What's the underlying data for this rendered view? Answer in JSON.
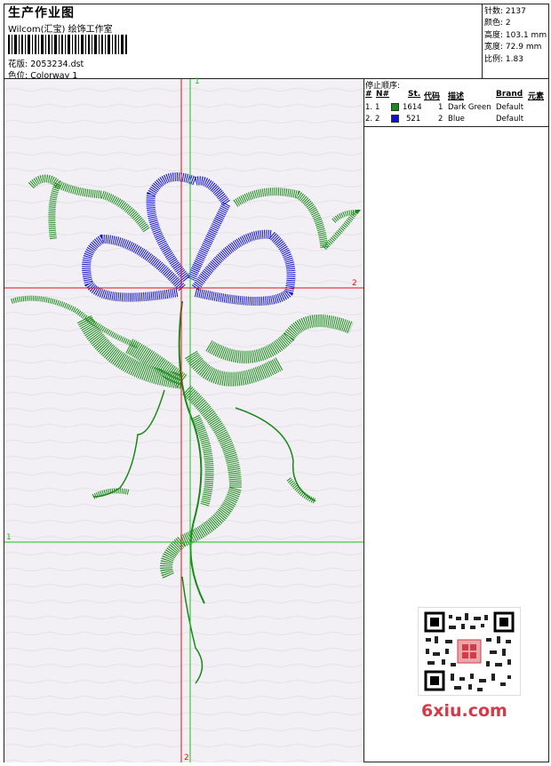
{
  "header": {
    "title": "生产作业图",
    "company": "Wilcom(汇宝) 绘饰工作室",
    "file_label": "花版:",
    "file_name": "2053234.dst",
    "colorway_label": "色位:",
    "colorway": "Colorway 1"
  },
  "stats": {
    "stitches_label": "针数:",
    "stitches": "2137",
    "colors_label": "颜色:",
    "colors": "2",
    "height_label": "高度:",
    "height": "103.1 mm",
    "width_label": "宽度:",
    "width": "72.9 mm",
    "scale_label": "比例:",
    "scale": "1.83"
  },
  "stop_sequence": {
    "title": "停止顺序:",
    "columns": [
      "#",
      "N#",
      "St.",
      "代码",
      "描述",
      "Brand",
      "元素"
    ],
    "rows": [
      {
        "idx": "1.",
        "n": "1",
        "color": "#1a8a1a",
        "stitches": "1614",
        "code": "1",
        "desc": "Dark Green",
        "brand": "Default"
      },
      {
        "idx": "2.",
        "n": "2",
        "color": "#1010d8",
        "stitches": "521",
        "code": "2",
        "desc": "Blue",
        "brand": "Default"
      }
    ]
  },
  "axes": {
    "v1": "1",
    "h1": "1",
    "v2": "2",
    "h2": "2"
  },
  "colors": {
    "green": "#1a8a1a",
    "blue": "#1010d8",
    "red_axis": "#e01010",
    "green_axis": "#18c018"
  },
  "watermark": "6xiu.com"
}
